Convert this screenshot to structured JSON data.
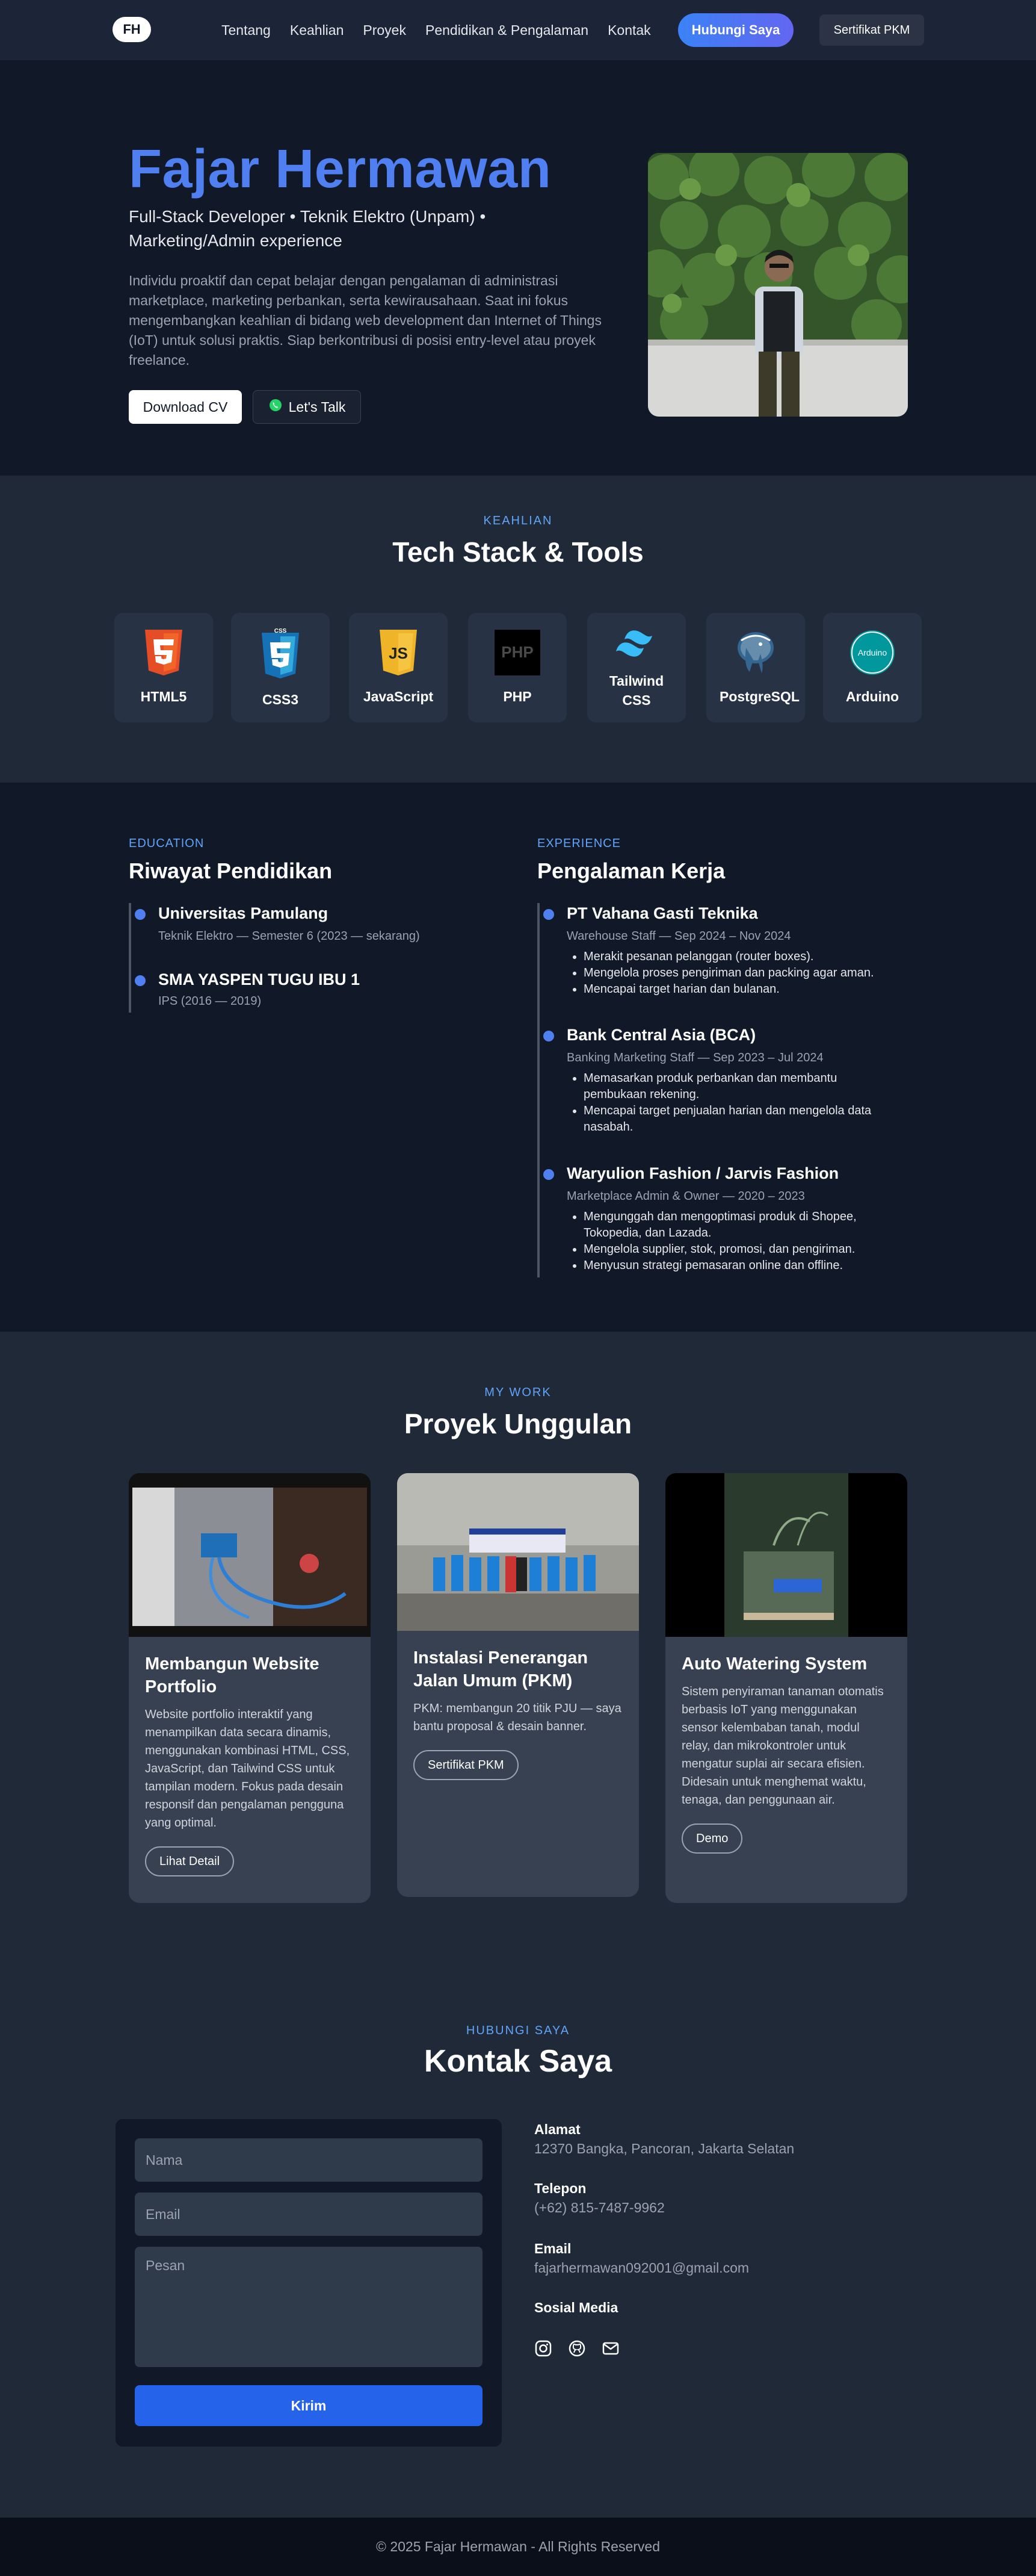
{
  "nav": {
    "logo": "FH",
    "links": [
      "Tentang",
      "Keahlian",
      "Proyek",
      "Pendidikan & Pengalaman",
      "Kontak"
    ],
    "cta": "Hubungi Saya",
    "cert": "Sertifikat PKM"
  },
  "hero": {
    "name": "Fajar Hermawan",
    "role": "Full-Stack Developer • Teknik Elektro (Unpam) • Marketing/Admin experience",
    "description": "Individu proaktif dan cepat belajar dengan pengalaman di administrasi marketplace, marketing perbankan, serta kewirausahaan. Saat ini fokus mengembangkan keahlian di bidang web development dan Internet of Things (IoT) untuk solusi praktis. Siap berkontribusi di posisi entry-level atau proyek freelance.",
    "btn_cv": "Download CV",
    "btn_talk": "Let's Talk"
  },
  "skills": {
    "kicker": "KEAHLIAN",
    "title": "Tech Stack & Tools",
    "items": [
      {
        "label": "HTML5",
        "icon": "html5-icon",
        "color": "#e44d26"
      },
      {
        "label": "CSS3",
        "icon": "css3-icon",
        "color": "#1572b6"
      },
      {
        "label": "JavaScript",
        "icon": "javascript-icon",
        "color": "#f0b429"
      },
      {
        "label": "PHP",
        "icon": "php-icon",
        "color": "#000000"
      },
      {
        "label": "Tailwind CSS",
        "icon": "tailwind-icon",
        "color": "#38bdf8"
      },
      {
        "label": "PostgreSQL",
        "icon": "postgresql-icon",
        "color": "#336791"
      },
      {
        "label": "Arduino",
        "icon": "arduino-icon",
        "color": "#00979d"
      }
    ]
  },
  "education": {
    "kicker": "EDUCATION",
    "title": "Riwayat Pendidikan",
    "items": [
      {
        "title": "Universitas Pamulang",
        "sub": "Teknik Elektro — Semester 6 (2023 — sekarang)"
      },
      {
        "title": "SMA YASPEN TUGU IBU 1",
        "sub": "IPS (2016 — 2019)"
      }
    ]
  },
  "experience": {
    "kicker": "EXPERIENCE",
    "title": "Pengalaman Kerja",
    "items": [
      {
        "title": "PT Vahana Gasti Teknika",
        "sub": "Warehouse Staff — Sep 2024 – Nov 2024",
        "bullets": [
          "Merakit pesanan pelanggan (router boxes).",
          "Mengelola proses pengiriman dan packing agar aman.",
          "Mencapai target harian dan bulanan."
        ]
      },
      {
        "title": "Bank Central Asia (BCA)",
        "sub": "Banking Marketing Staff — Sep 2023 – Jul 2024",
        "bullets": [
          "Memasarkan produk perbankan dan membantu pembukaan rekening.",
          "Mencapai target penjualan harian dan mengelola data nasabah."
        ]
      },
      {
        "title": "Waryulion Fashion / Jarvis Fashion",
        "sub": "Marketplace Admin & Owner — 2020 – 2023",
        "bullets": [
          "Mengunggah dan mengoptimasi produk di Shopee, Tokopedia, dan Lazada.",
          "Mengelola supplier, stok, promosi, dan pengiriman.",
          "Menyusun strategi pemasaran online dan offline."
        ]
      }
    ]
  },
  "projects": {
    "kicker": "MY WORK",
    "title": "Proyek Unggulan",
    "items": [
      {
        "title": "Membangun Website Portfolio",
        "desc": "Website portfolio interaktif yang menampilkan data secara dinamis, menggunakan kombinasi HTML, CSS, JavaScript, dan Tailwind CSS untuk tampilan modern. Fokus pada desain responsif dan pengalaman pengguna yang optimal.",
        "button": "Lihat Detail"
      },
      {
        "title": "Instalasi Penerangan Jalan Umum (PKM)",
        "desc": "PKM: membangun 20 titik PJU — saya bantu proposal & desain banner.",
        "button": "Sertifikat PKM"
      },
      {
        "title": "Auto Watering System",
        "desc": "Sistem penyiraman tanaman otomatis berbasis IoT yang menggunakan sensor kelembaban tanah, modul relay, dan mikrokontroler untuk mengatur suplai air secara efisien. Didesain untuk menghemat waktu, tenaga, dan penggunaan air.",
        "button": "Demo"
      }
    ]
  },
  "contact": {
    "kicker": "HUBUNGI SAYA",
    "title": "Kontak Saya",
    "form": {
      "name_placeholder": "Nama",
      "email_placeholder": "Email",
      "message_placeholder": "Pesan",
      "submit": "Kirim"
    },
    "address_label": "Alamat",
    "address": "12370 Bangka, Pancoran, Jakarta Selatan",
    "phone_label": "Telepon",
    "phone": "(+62) 815-7487-9962",
    "email_label": "Email",
    "email": "fajarhermawan092001@gmail.com",
    "social_label": "Sosial Media",
    "social_icons": [
      "instagram-icon",
      "github-icon",
      "mail-icon"
    ]
  },
  "footer": {
    "text": "© 2025 Fajar Hermawan - All Rights Reserved"
  }
}
